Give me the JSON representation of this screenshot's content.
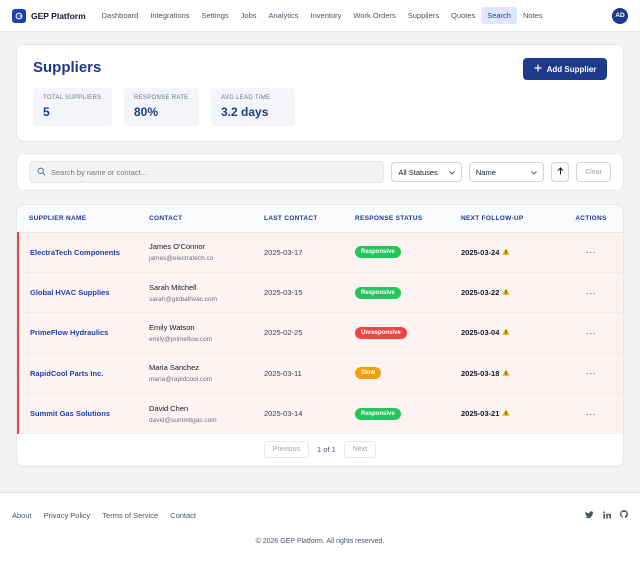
{
  "nav": {
    "brand": "GEP Platform",
    "items": [
      "Dashboard",
      "Integrations",
      "Settings",
      "Jobs",
      "Analytics",
      "Inventory",
      "Work Orders",
      "Suppliers",
      "Quotes",
      "Search",
      "Notes"
    ],
    "active": "Search",
    "avatar_initials": "AD"
  },
  "header": {
    "title": "Suppliers",
    "add_button_label": "Add Supplier",
    "stats": [
      {
        "label": "Total Suppliers",
        "value": "5"
      },
      {
        "label": "Response Rate",
        "value": "80%"
      },
      {
        "label": "Avg Lead Time",
        "value": "3.2 days"
      }
    ]
  },
  "filters": {
    "search_placeholder": "Search by name or contact...",
    "status_value": "All Statuses",
    "sort_value": "Name",
    "clear_label": "Clear"
  },
  "table": {
    "columns": [
      "Supplier Name",
      "Contact",
      "Last Contact",
      "Response Status",
      "Next Follow-up",
      "Actions"
    ],
    "rows": [
      {
        "name": "ElectraTech Components",
        "contact_name": "James O'Connor",
        "contact_email": "james@electratech.co",
        "last_contact": "2025-03-17",
        "status": "Responsive",
        "status_color": "#22c55e",
        "next_follow_up": "2025-03-24"
      },
      {
        "name": "Global HVAC Supplies",
        "contact_name": "Sarah Mitchell",
        "contact_email": "sarah@globalhvac.com",
        "last_contact": "2025-03-15",
        "status": "Responsive",
        "status_color": "#22c55e",
        "next_follow_up": "2025-03-22"
      },
      {
        "name": "PrimeFlow Hydraulics",
        "contact_name": "Emily Watson",
        "contact_email": "emily@primeflow.com",
        "last_contact": "2025-02-25",
        "status": "Unresponsive",
        "status_color": "#ef4444",
        "next_follow_up": "2025-03-04"
      },
      {
        "name": "RapidCool Parts Inc.",
        "contact_name": "Maria Sanchez",
        "contact_email": "maria@rapidcool.com",
        "last_contact": "2025-03-11",
        "status": "Slow",
        "status_color": "#f59e0b",
        "next_follow_up": "2025-03-18"
      },
      {
        "name": "Summit Gas Solutions",
        "contact_name": "David Chen",
        "contact_email": "david@summitgas.com",
        "last_contact": "2025-03-14",
        "status": "Responsive",
        "status_color": "#22c55e",
        "next_follow_up": "2025-03-21"
      }
    ],
    "actions_glyph": "···"
  },
  "pagination": {
    "previous_label": "Previous",
    "info": "1 of 1",
    "next_label": "Next"
  },
  "footer": {
    "links": [
      "About",
      "Privacy Policy",
      "Terms of Service",
      "Contact"
    ],
    "icons": [
      "twitter-icon",
      "linkedin-icon",
      "github-icon"
    ],
    "copyright": "© 2026 GEP Platform. All rights reserved."
  },
  "colors": {
    "brand": "#1e3a8a",
    "overdue_row_border": "#ef4444",
    "warning_icon": "#eab308"
  }
}
